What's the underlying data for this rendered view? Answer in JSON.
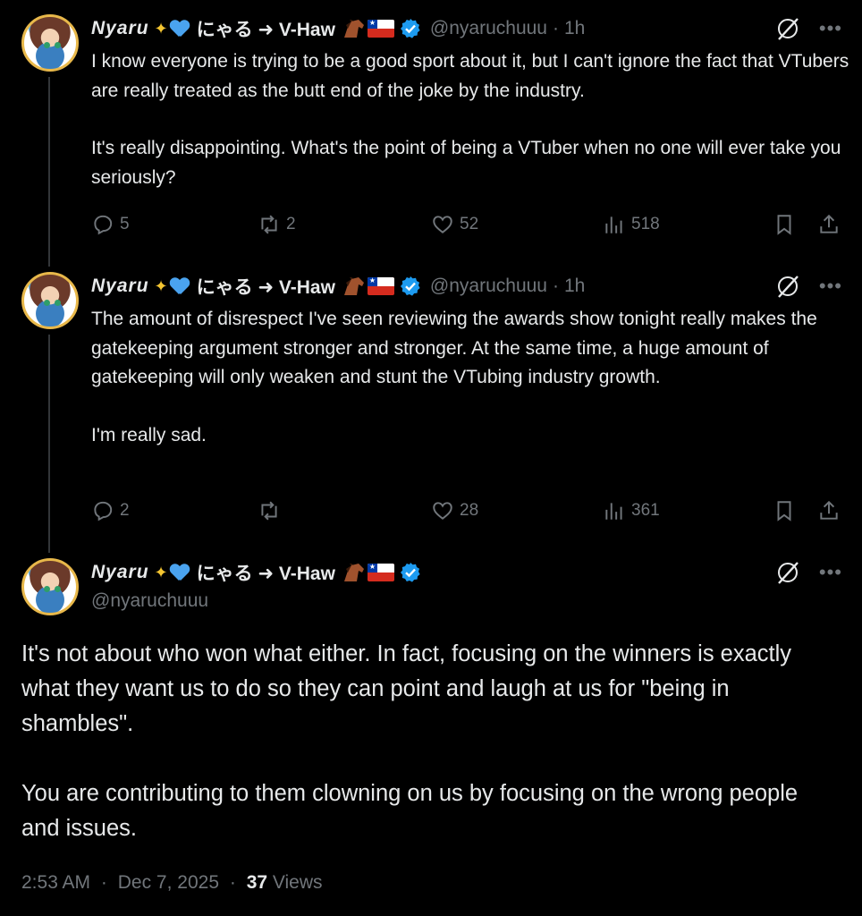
{
  "author": {
    "name_part1": "Nyaru",
    "name_part2": "にゃる ➜ V-Haw",
    "handle": "@nyaruchuuu"
  },
  "tweets": [
    {
      "time": "1h",
      "paragraphs": [
        "I know everyone is trying to be a good sport about it, but I can't ignore the fact that VTubers are really treated as the butt end of the joke by the industry.",
        "It's really disappointing. What's the point of being a VTuber when no one will ever take you seriously?"
      ],
      "replies": "5",
      "reposts": "2",
      "likes": "52",
      "views": "518"
    },
    {
      "time": "1h",
      "paragraphs": [
        "The amount of disrespect I've seen reviewing the awards show tonight really makes the gatekeeping argument stronger and stronger. At the same time, a huge amount of gatekeeping will only weaken and stunt the VTubing industry growth.",
        "I'm really sad."
      ],
      "replies": "2",
      "reposts": "",
      "likes": "28",
      "views": "361"
    }
  ],
  "main_tweet": {
    "paragraphs": [
      "It's not about who won what either. In fact, focusing on the winners is exactly what they want us to do so they can point and laugh at us for \"being in shambles\".",
      "You are contributing to them clowning on us by focusing on the wrong people and issues."
    ],
    "time": "2:53 AM",
    "date": "Dec 7, 2025",
    "views_count": "37",
    "views_label": "Views"
  },
  "separator_dot": "·",
  "colors": {
    "background": "#000000",
    "text": "#e7e9ea",
    "muted": "#71767b",
    "verified": "#1d9bf0",
    "thread_line": "#333639"
  },
  "icons": [
    "reply-icon",
    "repost-icon",
    "like-icon",
    "views-icon",
    "bookmark-icon",
    "share-icon",
    "grok-icon",
    "more-icon",
    "verified-badge-icon"
  ]
}
